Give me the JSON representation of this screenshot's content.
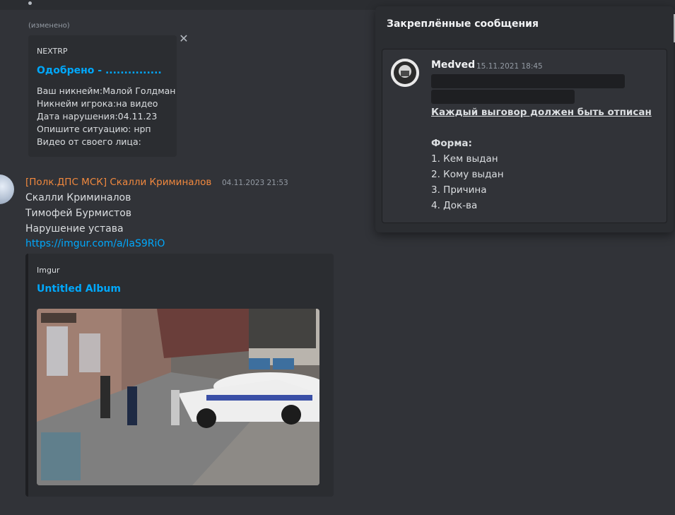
{
  "feed": {
    "edited_label": "(изменено)",
    "embed1": {
      "provider": "NEXTRP",
      "title": "Одобрено - ...............",
      "description": "Ваш никнейм:Малой Голдман\nНикнейм игрока:на видео\nДата нарушения:04.11.23\nОпишите ситуацию: нрп\nВидео от своего лица:"
    },
    "message": {
      "author": "[Полк.ДПС МСК] Скалли Криминалов",
      "timestamp": "04.11.2023 21:53",
      "lines": [
        "Скалли Криминалов",
        "Тимофей Бурмистов",
        "Нарушение устава"
      ],
      "link": "https://imgur.com/a/IaS9RiO",
      "embed": {
        "provider": "Imgur",
        "title": "Untitled Album"
      }
    }
  },
  "pinned": {
    "header": "Закреплённые сообщения",
    "message": {
      "author": "Medved",
      "timestamp": "15.11.2021 18:45",
      "bold_underlined": "Каждый выговор должен быть отписан",
      "form_label": "Форма:",
      "items": [
        "1. Кем выдан",
        "2. Кому выдан",
        "3. Причина",
        "4. Док-ва"
      ]
    }
  },
  "colors": {
    "background": "#313338",
    "panel": "#2b2d31",
    "link": "#00a8fc",
    "role_orange": "#f0883e"
  }
}
